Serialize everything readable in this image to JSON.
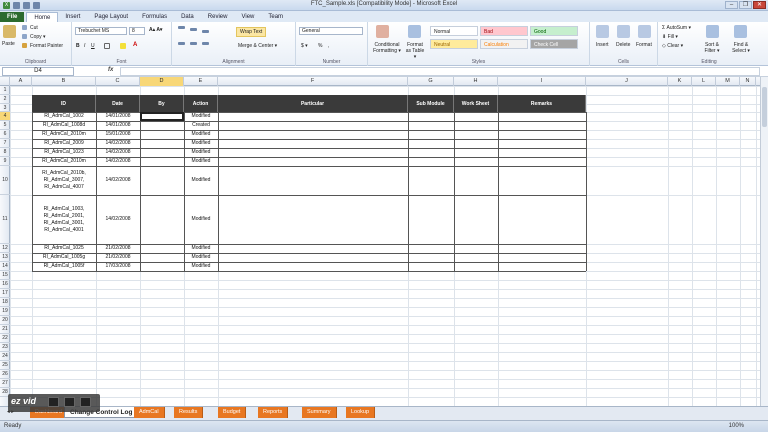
{
  "window": {
    "title": "FTC_Sample.xls  [Compatibility Mode]  -  Microsoft Excel",
    "min": "–",
    "max": "❐",
    "close": "✕"
  },
  "tabs": [
    "File",
    "Home",
    "Insert",
    "Page Layout",
    "Formulas",
    "Data",
    "Review",
    "View",
    "Team"
  ],
  "active_tab": "Home",
  "ribbon": {
    "clipboard": {
      "label": "Clipboard",
      "paste": "Paste",
      "cut": "Cut",
      "copy": "Copy ▾",
      "format_painter": "Format Painter"
    },
    "font": {
      "label": "Font",
      "name": "Trebuchet MS",
      "size": "8"
    },
    "alignment": {
      "label": "Alignment",
      "wrap": "Wrap Text",
      "merge": "Merge & Center ▾"
    },
    "number": {
      "label": "Number",
      "format": "General",
      "currency": "$ ▾",
      "percent": "%",
      "comma": ","
    },
    "styles": {
      "label": "Styles",
      "conditional": "Conditional Formatting ▾",
      "format_table": "Format as Table ▾",
      "items": [
        {
          "name": "Normal",
          "bg": "#ffffff",
          "fg": "#222222"
        },
        {
          "name": "Bad",
          "bg": "#ffc7ce",
          "fg": "#9c0006"
        },
        {
          "name": "Good",
          "bg": "#c6efce",
          "fg": "#006100"
        },
        {
          "name": "Neutral",
          "bg": "#ffeb9c",
          "fg": "#9c6500"
        },
        {
          "name": "Calculation",
          "bg": "#f2f2f2",
          "fg": "#fa7d00"
        },
        {
          "name": "Check Cell",
          "bg": "#a5a5a5",
          "fg": "#ffffff"
        }
      ]
    },
    "cells": {
      "label": "Cells",
      "insert": "Insert",
      "delete": "Delete",
      "format": "Format"
    },
    "editing": {
      "label": "Editing",
      "autosum": "AutoSum ▾",
      "fill": "Fill ▾",
      "clear": "Clear ▾",
      "sort": "Sort & Filter ▾",
      "find": "Find & Select ▾"
    }
  },
  "formula_bar": {
    "name_box": "D4",
    "fx": "fx",
    "value": ""
  },
  "columns": [
    "A",
    "B",
    "C",
    "D",
    "E",
    "F",
    "G",
    "H",
    "I",
    "J",
    "K",
    "L",
    "M",
    "N"
  ],
  "selected_column": "D",
  "rows": [
    "1",
    "2",
    "3",
    "4",
    "5",
    "6",
    "7",
    "8",
    "9",
    "10",
    "11",
    "12",
    "13",
    "14",
    "15",
    "16",
    "17",
    "18",
    "19",
    "20",
    "21",
    "22",
    "23",
    "24",
    "25",
    "26",
    "27",
    "28"
  ],
  "selected_row": "4",
  "table_headers": [
    "ID",
    "Date",
    "By",
    "Action",
    "Particular",
    "Sub Module",
    "Work Sheet",
    "Remarks"
  ],
  "table_rows": [
    {
      "id": "RI_AdmCal_1002",
      "date": "14/01/2008",
      "by": "",
      "action": "Modified"
    },
    {
      "id": "RI_AdmCal_1008d",
      "date": "14/01/2008",
      "by": "",
      "action": "Created"
    },
    {
      "id": "RI_AdmCal_2010m",
      "date": "15/01/2008",
      "by": "",
      "action": "Modified"
    },
    {
      "id": "RI_AdmCal_2009",
      "date": "14/02/2008",
      "by": "",
      "action": "Modified"
    },
    {
      "id": "RI_AdmCal_1023",
      "date": "14/02/2008",
      "by": "",
      "action": "Modified"
    },
    {
      "id": "RI_AdmCal_2010m",
      "date": "14/02/2008",
      "by": "",
      "action": "Modified"
    },
    {
      "id": "RI_AdmCal_2010b,\nRI_AdmCal_3007,\nRI_AdmCal_4007",
      "date": "14/02/2008",
      "by": "",
      "action": "Modified"
    },
    {
      "id": "RI_AdmCal_1003,\nRI_AdmCal_2001,\nRI_AdmCal_3001,\nRI_AdmCal_4001",
      "date": "14/02/2008",
      "by": "",
      "action": "Modified"
    },
    {
      "id": "RI_AdmCal_1025",
      "date": "21/02/2008",
      "by": "",
      "action": "Modified"
    },
    {
      "id": "RI_AdmCal_1005g",
      "date": "21/02/2008",
      "by": "",
      "action": "Modified"
    },
    {
      "id": "RI_AdmCal_1005f",
      "date": "17/03/2008",
      "by": "",
      "action": "Modified"
    }
  ],
  "sheet_tabs": {
    "active": "Change Control Log",
    "others": [
      "Dashboard",
      "AdmCal",
      "Results",
      "Budget",
      "Reports",
      "Summary",
      "Lookup"
    ]
  },
  "status": {
    "ready": "Ready",
    "zoom": "100%"
  },
  "watermark": {
    "text": "ez vid"
  }
}
